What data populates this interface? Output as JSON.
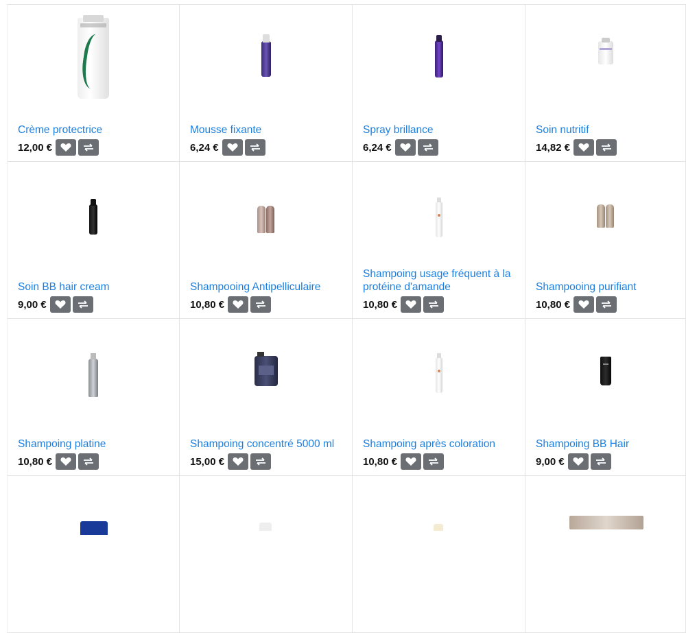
{
  "currency_symbol": "€",
  "products": [
    {
      "name": "Crème protectrice",
      "price": "12,00 €",
      "image": "white-tube-green-swirl"
    },
    {
      "name": "Mousse fixante",
      "price": "6,24 €",
      "image": "purple-mousse-bottle"
    },
    {
      "name": "Spray brillance",
      "price": "6,24 €",
      "image": "purple-spray-can"
    },
    {
      "name": "Soin nutritif",
      "price": "14,82 €",
      "image": "small-white-bottle"
    },
    {
      "name": "Soin BB hair cream",
      "price": "9,00 €",
      "image": "black-spray-bottle"
    },
    {
      "name": "Shampooing Antipelliculaire",
      "price": "10,80 €",
      "image": "two-rose-bottles"
    },
    {
      "name": "Shampoing usage fréquent à la protéine d'amande",
      "price": "10,80 €",
      "image": "slim-white-bottle"
    },
    {
      "name": "Shampooing purifiant",
      "price": "10,80 €",
      "image": "two-beige-bottles"
    },
    {
      "name": "Shampoing platine",
      "price": "10,80 €",
      "image": "silver-bottle"
    },
    {
      "name": "Shampoing concentré 5000 ml",
      "price": "15,00 €",
      "image": "dark-jerrycan"
    },
    {
      "name": "Shampoing après coloration",
      "price": "10,80 €",
      "image": "slim-white-bottle"
    },
    {
      "name": "Shampoing BB Hair",
      "price": "9,00 €",
      "image": "black-tube"
    }
  ],
  "buttons": {
    "wishlist_icon": "heart-icon",
    "compare_icon": "compare-arrows-icon"
  },
  "colors": {
    "link": "#1b7fe0",
    "button_bg": "#6b6f74",
    "border": "#e4e4e4"
  }
}
